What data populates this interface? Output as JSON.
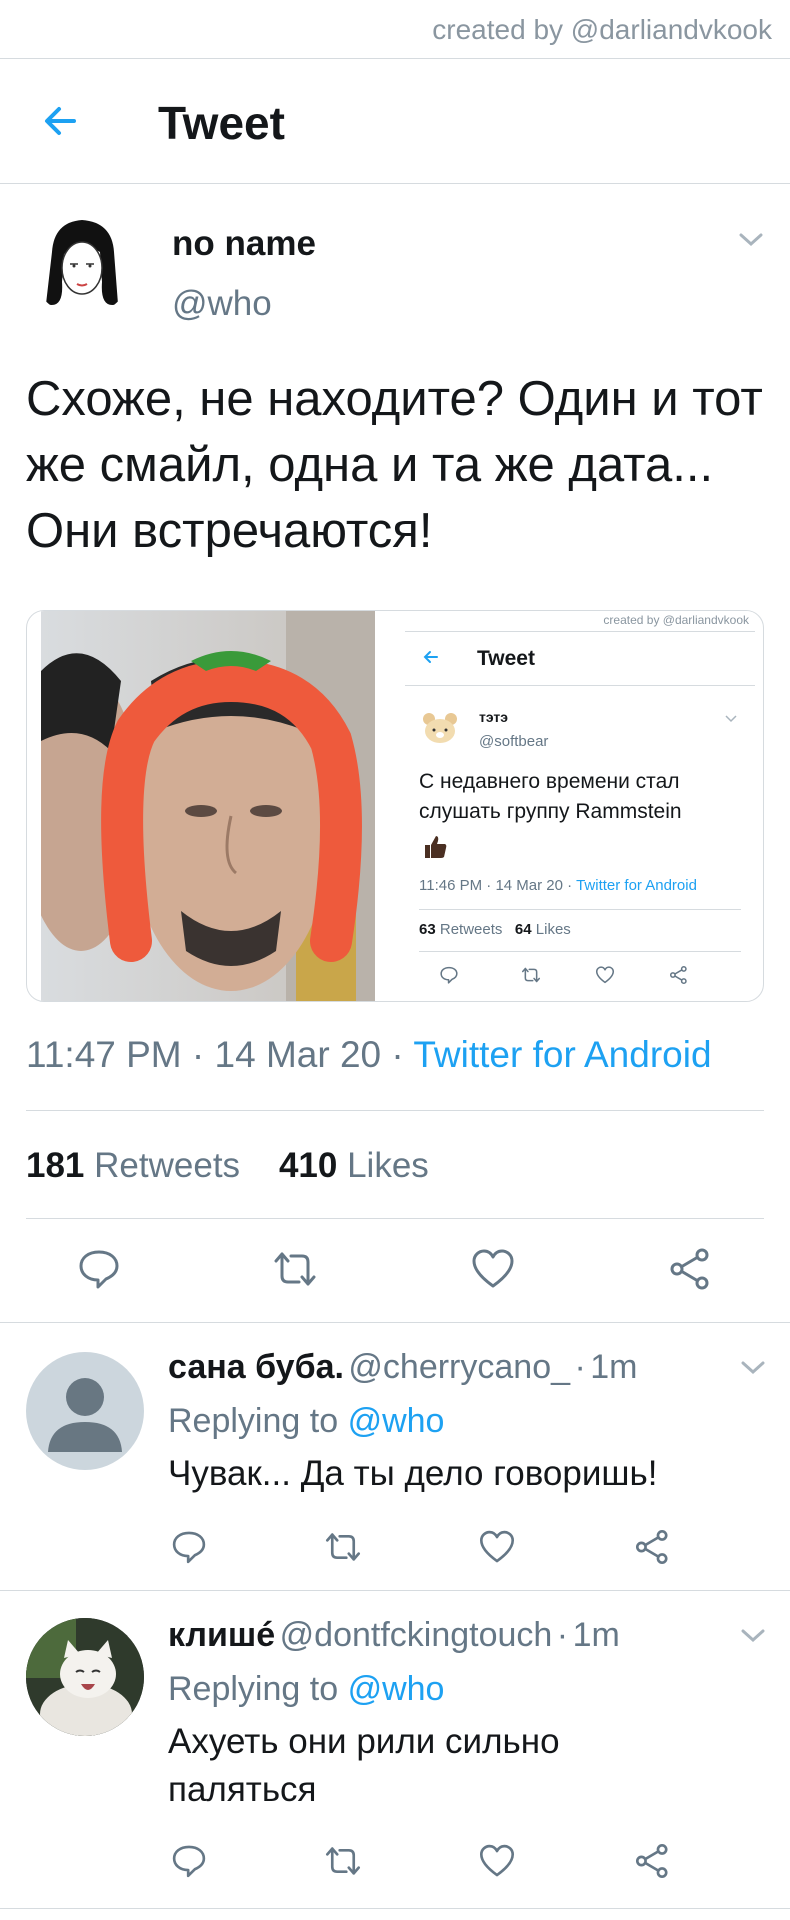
{
  "watermark": "created by @darliandvkook",
  "header": {
    "title": "Tweet",
    "back_icon": "arrow-left-icon"
  },
  "tweet": {
    "author_name": "no name",
    "author_handle": "@who",
    "text": "Схоже, не находите? Один и тот же смайл, одна и та же дата... Они встречаются!",
    "time": "11:47 PM",
    "date": "14 Mar 20",
    "source": "Twitter for Android",
    "retweets": "181",
    "retweets_label": "Retweets",
    "likes": "410",
    "likes_label": "Likes"
  },
  "embedded": {
    "watermark": "created by @darliandvkook",
    "title": "Tweet",
    "author_name": "тэтэ",
    "author_handle": "@softbear",
    "text_line1": "С недавнего времени стал",
    "text_line2": "слушать группу Rammstein",
    "time": "11:46 PM",
    "date": "14 Mar 20",
    "source": "Twitter for Android",
    "retweets": "63",
    "retweets_label": "Retweets",
    "likes": "64",
    "likes_label": "Likes"
  },
  "separator": "·",
  "replies": [
    {
      "name": "сана буба.",
      "handle": "@cherrycano_",
      "time": "1m",
      "replying_prefix": "Replying to",
      "replying_to": "@who",
      "text": "Чувак... Да ты дело говоришь!"
    },
    {
      "name": "клишé",
      "handle": "@dontfckingtouch",
      "time": "1m",
      "replying_prefix": "Replying to",
      "replying_to": "@who",
      "text": "Ахуеть они рили сильно паляться"
    }
  ],
  "colors": {
    "accent": "#1da1f2",
    "text": "#14171a",
    "secondary": "#657786",
    "divider": "#d6dbdf"
  }
}
